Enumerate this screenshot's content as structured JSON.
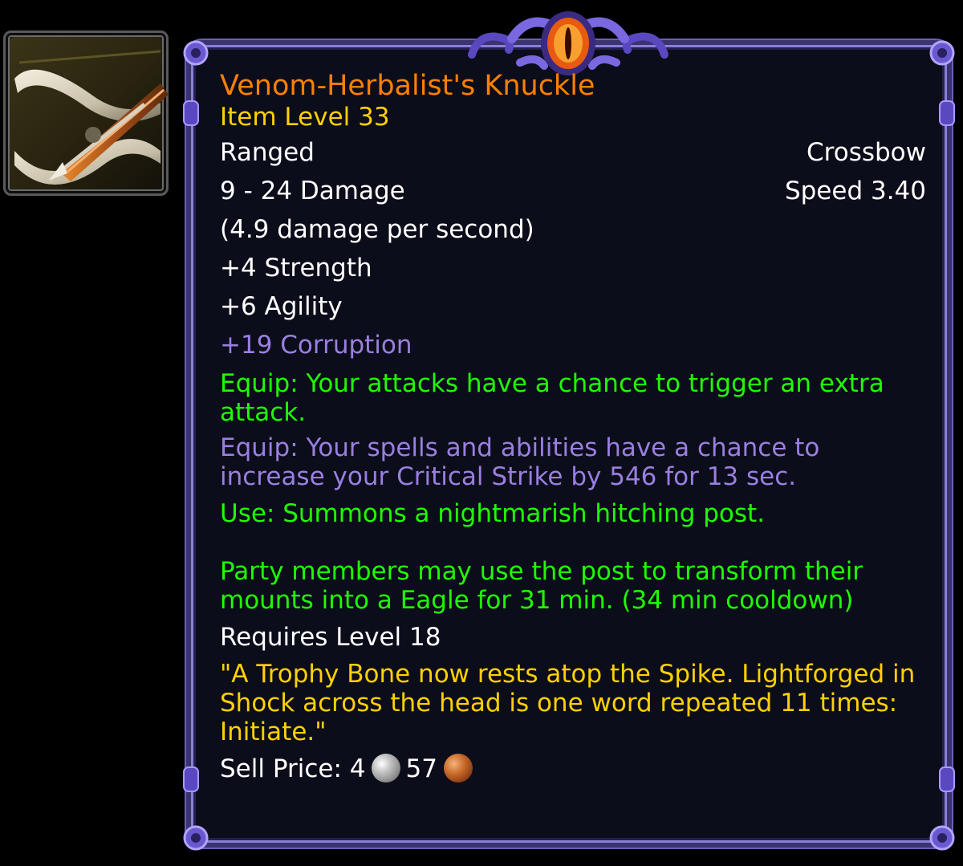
{
  "item": {
    "name": "Venom-Herbalist's Knuckle",
    "item_level": "Item Level 33",
    "slot": "Ranged",
    "type": "Crossbow",
    "damage": "9 - 24 Damage",
    "speed": "Speed 3.40",
    "dps": "(4.9 damage per second)",
    "stats": [
      "+4 Strength",
      "+6 Agility"
    ],
    "corruption": "+19 Corruption",
    "equip_1": "Equip: Your attacks have a chance to trigger an extra attack.",
    "equip_2": "Equip: Your spells and abilities have a chance to increase your Critical Strike by 546 for 13 sec.",
    "use_line_1": "Use: Summons a nightmarish hitching post.",
    "use_line_2": "Party members may use the post to transform their mounts into a Eagle for 31 min. (34 min cooldown)",
    "requires": "Requires Level 18",
    "flavor": "\"A Trophy Bone now rests atop the Spike. Lightforged in Shock across the head is one word repeated 11 times: Initiate.\"",
    "sell_label": "Sell Price: 4",
    "sell_copper": "57",
    "icon": "crossbow-icon",
    "colors": {
      "name": "#ff8000",
      "item_level": "#ffd100",
      "corruption": "#9a7fe0",
      "equip_green": "#1eff00",
      "flavor": "#ffd100"
    }
  }
}
